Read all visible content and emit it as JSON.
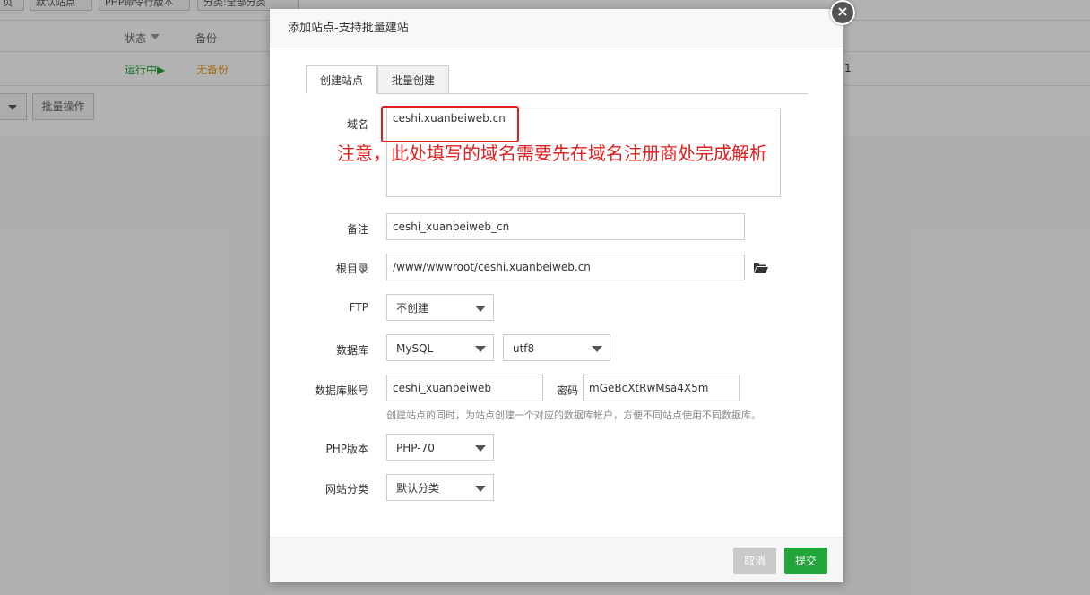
{
  "background": {
    "top_buttons": [
      "页",
      "默认站点",
      "PHP命令行版本",
      "分类:全部分类"
    ],
    "table_headers": {
      "status": "状态",
      "backup": "备份"
    },
    "row": {
      "status": "运行中▶",
      "backup": "无备份",
      "extra": "1"
    },
    "batch_button": "批量操作"
  },
  "modal": {
    "title": "添加站点-支持批量建站",
    "close_symbol": "×",
    "tabs": [
      {
        "label": "创建站点",
        "active": true
      },
      {
        "label": "批量创建",
        "active": false
      }
    ],
    "domain": {
      "label": "域名",
      "value": "ceshi.xuanbeiweb.cn"
    },
    "notice": "注意，此处填写的域名需要先在域名注册商处完成解析",
    "remark": {
      "label": "备注",
      "value": "ceshi_xuanbeiweb_cn"
    },
    "root_dir": {
      "label": "根目录",
      "value": "/www/wwwroot/ceshi.xuanbeiweb.cn"
    },
    "ftp": {
      "label": "FTP",
      "value": "不创建"
    },
    "database": {
      "label": "数据库",
      "type": "MySQL",
      "charset": "utf8"
    },
    "db_account": {
      "label": "数据库账号",
      "user": "ceshi_xuanbeiweb",
      "password_label": "密码",
      "password": "mGeBcXtRwMsa4X5m"
    },
    "db_hint": "创建站点的同时，为站点创建一个对应的数据库帐户，方便不同站点使用不同数据库。",
    "php_version": {
      "label": "PHP版本",
      "value": "PHP-70"
    },
    "category": {
      "label": "网站分类",
      "value": "默认分类"
    },
    "buttons": {
      "cancel": "取消",
      "submit": "提交"
    }
  },
  "colors": {
    "primary": "#20a53a",
    "notice": "#e02020",
    "running": "#20a53a",
    "no_backup": "#f0a020"
  },
  "icons": {
    "folder": "folder-open-icon",
    "close": "close-icon",
    "dropdown": "chevron-down-icon"
  }
}
